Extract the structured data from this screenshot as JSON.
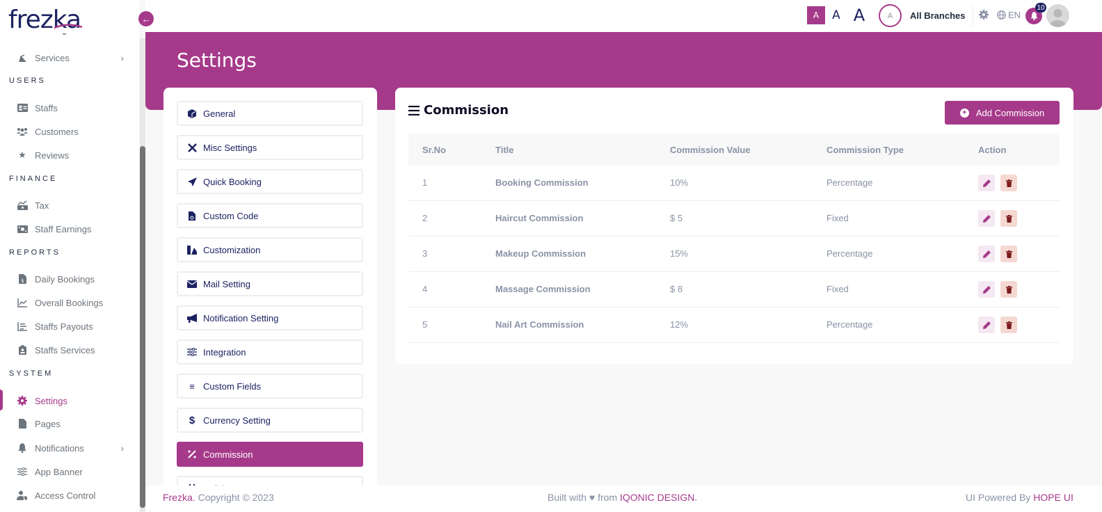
{
  "app": {
    "logo": "frezka"
  },
  "sidebar": {
    "items": [
      {
        "label": "Services",
        "icon": "services-icon",
        "has_children": true
      },
      {
        "section": "USERS"
      },
      {
        "label": "Staffs",
        "icon": "id-card-icon"
      },
      {
        "label": "Customers",
        "icon": "users-icon"
      },
      {
        "label": "Reviews",
        "icon": "star-icon"
      },
      {
        "section": "FINANCE"
      },
      {
        "label": "Tax",
        "icon": "tax-icon"
      },
      {
        "label": "Staff Earnings",
        "icon": "money-icon"
      },
      {
        "section": "REPORTS"
      },
      {
        "label": "Daily Bookings",
        "icon": "invoice-icon"
      },
      {
        "label": "Overall Bookings",
        "icon": "line-chart-icon"
      },
      {
        "label": "Staffs Payouts",
        "icon": "bar-chart-icon"
      },
      {
        "label": "Staffs Services",
        "icon": "badge-icon"
      },
      {
        "section": "SYSTEM"
      },
      {
        "label": "Settings",
        "icon": "gear-icon",
        "active": true
      },
      {
        "label": "Pages",
        "icon": "file-icon"
      },
      {
        "label": "Notifications",
        "icon": "bell-icon",
        "has_children": true
      },
      {
        "label": "App Banner",
        "icon": "sliders-icon"
      },
      {
        "label": "Access Control",
        "icon": "user-shield-icon"
      }
    ]
  },
  "header": {
    "font_sizes": [
      "A",
      "A",
      "A"
    ],
    "branch_avatar": "A",
    "branch_name": "All Branches",
    "language": "EN",
    "notification_count": "10"
  },
  "page": {
    "title": "Settings"
  },
  "settings_menu": {
    "items": [
      {
        "label": "General",
        "icon": "cube-icon"
      },
      {
        "label": "Misc Settings",
        "icon": "tools-icon"
      },
      {
        "label": "Quick Booking",
        "icon": "paper-plane-icon"
      },
      {
        "label": "Custom Code",
        "icon": "file-code-icon"
      },
      {
        "label": "Customization",
        "icon": "swatch-icon"
      },
      {
        "label": "Mail Setting",
        "icon": "envelope-icon"
      },
      {
        "label": "Notification Setting",
        "icon": "megaphone-icon"
      },
      {
        "label": "Integration",
        "icon": "sliders-icon"
      },
      {
        "label": "Custom Fields",
        "icon": "bars-icon"
      },
      {
        "label": "Currency Setting",
        "icon": "dollar-icon"
      },
      {
        "label": "Commission",
        "icon": "percent-icon",
        "active": true
      },
      {
        "label": "Holidays",
        "icon": "calendar-icon"
      }
    ]
  },
  "commission": {
    "title": "Commission",
    "add_button": "Add Commission",
    "columns": [
      "Sr.No",
      "Title",
      "Commission Value",
      "Commission Type",
      "Action"
    ],
    "rows": [
      {
        "sr": "1",
        "title": "Booking Commission",
        "value": "10%",
        "type": "Percentage"
      },
      {
        "sr": "2",
        "title": "Haircut Commission",
        "value": "$ 5",
        "type": "Fixed"
      },
      {
        "sr": "3",
        "title": "Makeup Commission",
        "value": "15%",
        "type": "Percentage"
      },
      {
        "sr": "4",
        "title": "Massage Commission",
        "value": "$ 8",
        "type": "Fixed"
      },
      {
        "sr": "5",
        "title": "Nail Art Commission",
        "value": "12%",
        "type": "Percentage"
      }
    ]
  },
  "footer": {
    "brand": "Frezka.",
    "copyright": " Copyright © 2023",
    "built_with": "Built with ♥ from ",
    "built_by": "IQONIC DESIGN.",
    "powered_by": "UI Powered By ",
    "powered_link": "HOPE UI"
  },
  "colors": {
    "accent": "#a63a8a",
    "navy": "#1c2262",
    "muted": "#8a92a6",
    "delete_bg": "#f5d8d2",
    "edit_bg": "#f5e8f2"
  }
}
